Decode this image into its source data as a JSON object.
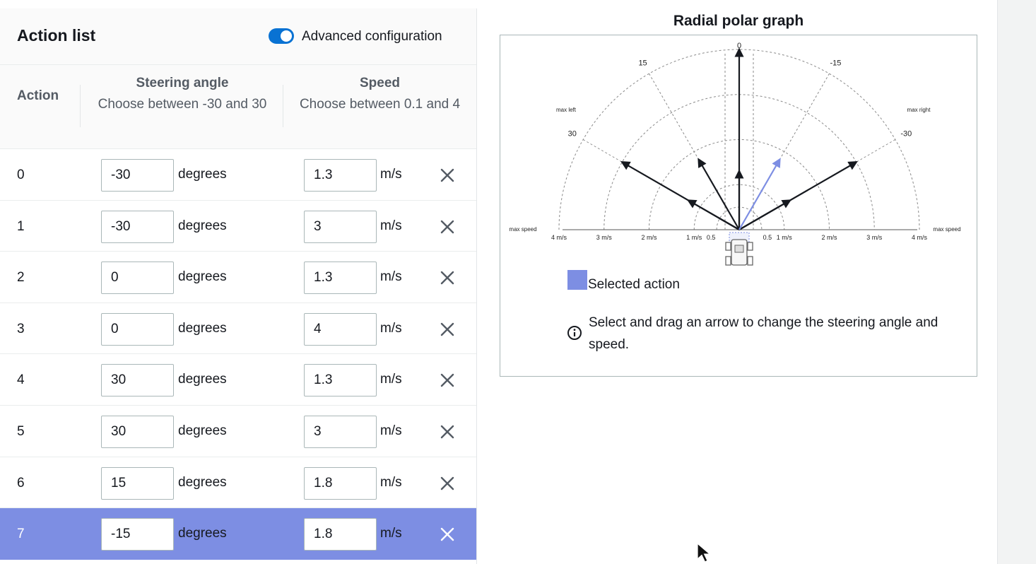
{
  "panel": {
    "title": "Action list",
    "toggle_label": "Advanced configuration",
    "toggle_on": true
  },
  "table": {
    "col_action": "Action",
    "col_steering_title": "Steering angle",
    "col_steering_hint": "Choose between -30 and 30",
    "col_speed_title": "Speed",
    "col_speed_hint": "Choose between 0.1 and 4",
    "unit_steering": "degrees",
    "unit_speed": "m/s",
    "rows": [
      {
        "index": "0",
        "steering": "-30",
        "speed": "1.3",
        "selected": false
      },
      {
        "index": "1",
        "steering": "-30",
        "speed": "3",
        "selected": false
      },
      {
        "index": "2",
        "steering": "0",
        "speed": "1.3",
        "selected": false
      },
      {
        "index": "3",
        "steering": "0",
        "speed": "4",
        "selected": false
      },
      {
        "index": "4",
        "steering": "30",
        "speed": "1.3",
        "selected": false
      },
      {
        "index": "5",
        "steering": "30",
        "speed": "3",
        "selected": false
      },
      {
        "index": "6",
        "steering": "15",
        "speed": "1.8",
        "selected": false
      },
      {
        "index": "7",
        "steering": "-15",
        "speed": "1.8",
        "selected": true
      }
    ]
  },
  "graph": {
    "title": "Radial polar graph",
    "angle_labels": {
      "a0": "0",
      "a15": "15",
      "am15": "-15",
      "a30": "30",
      "am30": "-30"
    },
    "max_left": "max left",
    "max_right": "max right",
    "max_speed": "max speed",
    "speed_labels": [
      "0.5",
      "1 m/s",
      "2 m/s",
      "3 m/s",
      "4 m/s"
    ],
    "legend_label": "Selected action",
    "info_text": "Select and drag an arrow to change the steering angle and speed.",
    "arrow_color": "#16191f",
    "selected_color": "#7d8ee3",
    "max_speed_value": 4,
    "max_angle_value": 30
  }
}
